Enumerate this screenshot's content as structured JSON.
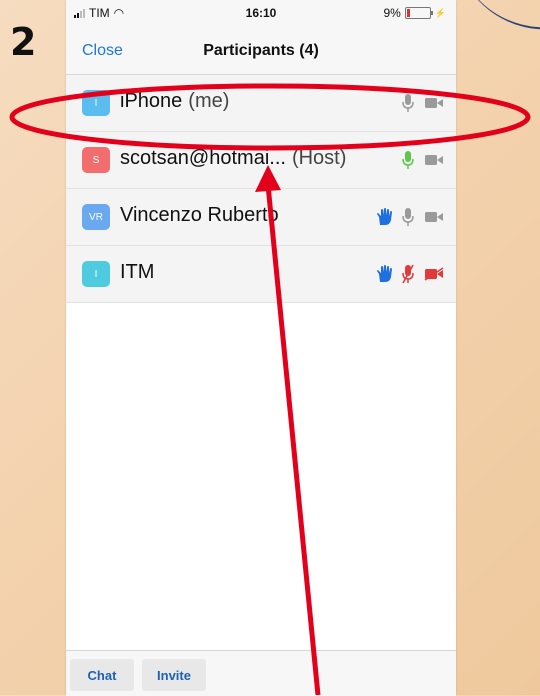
{
  "step_number": "2",
  "status_bar": {
    "carrier": "TIM",
    "time": "16:10",
    "battery": "9%"
  },
  "nav": {
    "close_label": "Close",
    "title": "Participants (4)"
  },
  "participants": [
    {
      "initials": "I",
      "name": "iPhone",
      "tag": "(me)",
      "avatar_color": "#5bbcf0",
      "hand_raised": false,
      "mic": "on",
      "video": "off"
    },
    {
      "initials": "S",
      "name": "scotsan@hotmai...",
      "tag": "(Host)",
      "avatar_color": "#f26d6d",
      "hand_raised": false,
      "mic": "active",
      "video": "off"
    },
    {
      "initials": "VR",
      "name": "Vincenzo Ruberto",
      "tag": "",
      "avatar_color": "#6aa8f0",
      "hand_raised": true,
      "mic": "on",
      "video": "off"
    },
    {
      "initials": "I",
      "name": "ITM",
      "tag": "",
      "avatar_color": "#4fcbe0",
      "hand_raised": true,
      "mic": "muted",
      "video": "muted"
    }
  ],
  "bottom": {
    "chat_label": "Chat",
    "invite_label": "Invite"
  },
  "colors": {
    "accent": "#1d78d6",
    "annotation": "#e3001b",
    "hand": "#1f6fe0",
    "mic_active": "#5cc84a",
    "muted": "#e23a3a"
  }
}
